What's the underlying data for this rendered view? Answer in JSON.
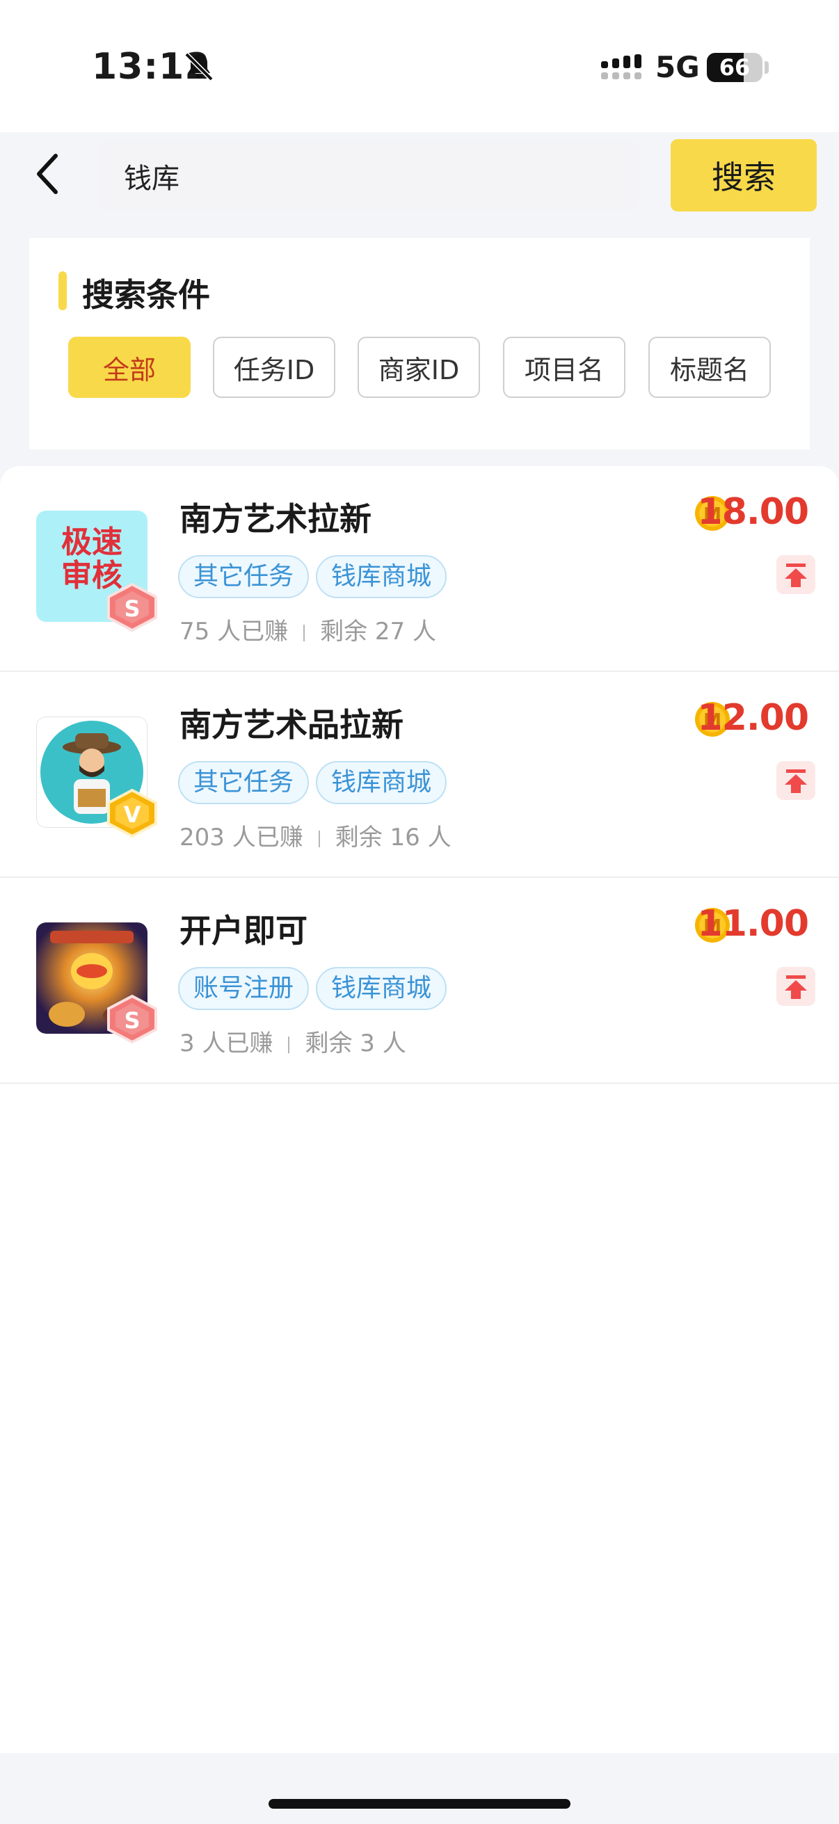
{
  "status_bar": {
    "time": "13:12",
    "network": "5G",
    "battery": "66",
    "icons": [
      "bell-mute-icon",
      "signal-icon"
    ]
  },
  "search": {
    "value": "钱库",
    "button_label": "搜索",
    "back_icon": "chevron-left-icon"
  },
  "conditions": {
    "title": "搜索条件",
    "chips": [
      {
        "label": "全部",
        "active": true
      },
      {
        "label": "任务ID",
        "active": false
      },
      {
        "label": "商家ID",
        "active": false
      },
      {
        "label": "项目名",
        "active": false
      },
      {
        "label": "标题名",
        "active": false
      }
    ]
  },
  "tasks": [
    {
      "title": "南方艺术拉新",
      "thumb_text": "极速审核",
      "badge": "S",
      "tags": [
        "其它任务",
        "钱库商城"
      ],
      "earned": "75 人已赚",
      "remaining": "剩余 27 人",
      "price": "18.00",
      "coin_letter": "M"
    },
    {
      "title": "南方艺术品拉新",
      "badge": "V",
      "tags": [
        "其它任务",
        "钱库商城"
      ],
      "earned": "203 人已赚",
      "remaining": "剩余 16 人",
      "price": "12.00",
      "coin_letter": "M"
    },
    {
      "title": "开户即可",
      "badge": "S",
      "tags": [
        "账号注册",
        "钱库商城"
      ],
      "earned": "3 人已赚",
      "remaining": "剩余 3 人",
      "price": "11.00",
      "coin_letter": "M"
    }
  ],
  "colors": {
    "accent": "#f8d94a",
    "price": "#e33a2e",
    "tag": "#3a93d6"
  }
}
